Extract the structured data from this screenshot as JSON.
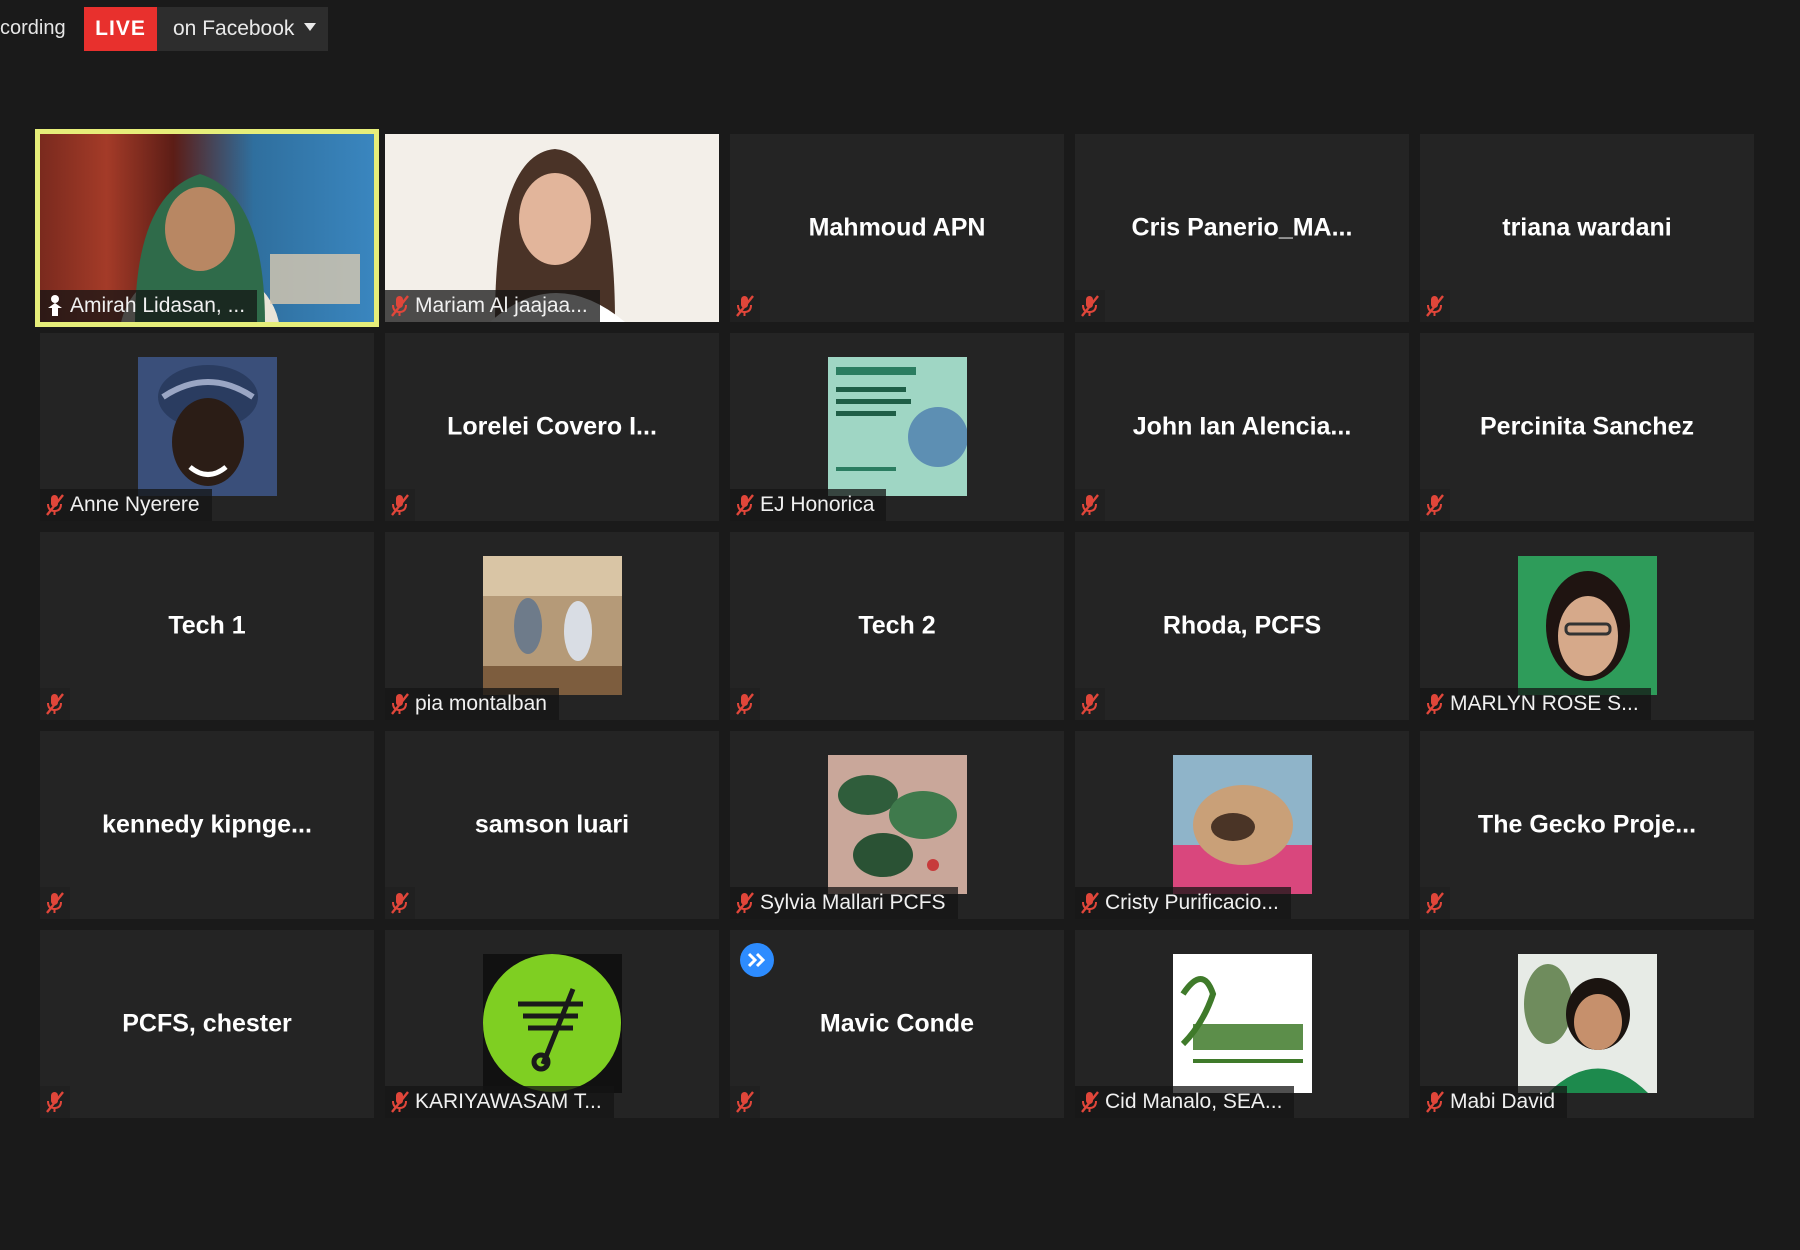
{
  "topbar": {
    "recording_text": "cording",
    "live_label": "LIVE",
    "stream_target": "on Facebook"
  },
  "tiles": [
    {
      "name": "Amirah Lidasan, ...",
      "display": "video",
      "label_tag": "Amirah Lidasan, ...",
      "pinned": true,
      "active_speaker": true
    },
    {
      "name": "Mariam Al jaajaa...",
      "display": "video",
      "label_tag": "Mariam Al jaajaa...",
      "muted": true
    },
    {
      "name": "Mahmoud APN",
      "display": "name",
      "muted": true
    },
    {
      "name": "Cris  Panerio_MA...",
      "display": "name",
      "muted": true
    },
    {
      "name": "triana wardani",
      "display": "name",
      "muted": true
    },
    {
      "name": "Anne Nyerere",
      "display": "avatar",
      "label_tag": "Anne Nyerere",
      "muted": true
    },
    {
      "name": "Lorelei  Covero  I...",
      "display": "name",
      "muted": true
    },
    {
      "name": "EJ Honorica",
      "display": "avatar",
      "label_tag": "EJ Honorica",
      "muted": true
    },
    {
      "name": "John  Ian  Alencia...",
      "display": "name",
      "muted": true
    },
    {
      "name": "Percinita Sanchez",
      "display": "name",
      "muted": true
    },
    {
      "name": "Tech 1",
      "display": "name",
      "muted": true
    },
    {
      "name": "pia montalban",
      "display": "avatar",
      "label_tag": "pia montalban",
      "muted": true
    },
    {
      "name": "Tech 2",
      "display": "name",
      "muted": true
    },
    {
      "name": "Rhoda, PCFS",
      "display": "name",
      "muted": true
    },
    {
      "name": "MARLYN ROSE S...",
      "display": "avatar",
      "label_tag": "MARLYN ROSE S...",
      "muted": true
    },
    {
      "name": "kennedy  kipnge...",
      "display": "name",
      "muted": true
    },
    {
      "name": "samson luari",
      "display": "name",
      "muted": true
    },
    {
      "name": "Sylvia Mallari PCFS",
      "display": "avatar",
      "label_tag": "Sylvia Mallari PCFS",
      "muted": true
    },
    {
      "name": "Cristy Purificacio...",
      "display": "avatar",
      "label_tag": "Cristy Purificacio...",
      "muted": true
    },
    {
      "name": "The  Gecko  Proje...",
      "display": "name",
      "muted": true
    },
    {
      "name": "PCFS, chester",
      "display": "name",
      "muted": true
    },
    {
      "name": "KARIYAWASAM T...",
      "display": "avatar",
      "label_tag": "KARIYAWASAM T...",
      "muted": true
    },
    {
      "name": "Mavic Conde",
      "display": "name",
      "muted": true,
      "badge": "fast-forward-icon"
    },
    {
      "name": "Cid Manalo, SEA...",
      "display": "avatar",
      "label_tag": "Cid Manalo, SEA...",
      "muted": true
    },
    {
      "name": "Mabi David",
      "display": "avatar",
      "label_tag": "Mabi David",
      "muted": true
    }
  ],
  "colors": {
    "background": "#1a1a1a",
    "tile": "#242424",
    "live_red": "#e8302d",
    "active_speaker_border": "#e6ee7a",
    "mute_red": "#e0463a",
    "badge_blue": "#2d8cff"
  }
}
